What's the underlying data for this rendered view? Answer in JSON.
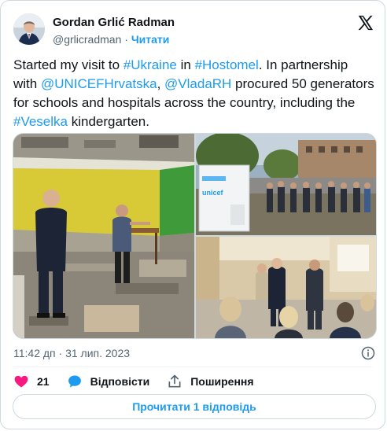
{
  "author": {
    "name": "Gordan Grlić Radman",
    "handle": "@grlicradman",
    "separator": "·",
    "follow_label": "Читати"
  },
  "tweet": {
    "segments": [
      {
        "text": "Started my visit to ",
        "tag": false
      },
      {
        "text": "#Ukraine",
        "tag": true
      },
      {
        "text": " in ",
        "tag": false
      },
      {
        "text": "#Hostomel",
        "tag": true
      },
      {
        "text": ". In partnership with ",
        "tag": false
      },
      {
        "text": "@UNICEFHrvatska",
        "tag": true
      },
      {
        "text": ", ",
        "tag": false
      },
      {
        "text": "@VladaRH",
        "tag": true
      },
      {
        "text": " procured 50 generators for schools and hospitals across the country, including the ",
        "tag": false
      },
      {
        "text": "#Veselka",
        "tag": true
      },
      {
        "text": " kindergarten.",
        "tag": false
      }
    ],
    "timestamp": "11:42 дп · 31 лип. 2023"
  },
  "media": {
    "photo_1": "classroom-ruins-photo",
    "photo_2": "unicef-generator-photo",
    "photo_3": "meeting-hall-photo",
    "generator_brand": "unicef"
  },
  "actions": {
    "likes_count": "21",
    "reply_label": "Відповісти",
    "share_label": "Поширення"
  },
  "read_replies_label": "Прочитати 1 відповідь",
  "colors": {
    "accent": "#1d9bf0",
    "like": "#f91880",
    "text": "#0f1419",
    "muted": "#536471",
    "border": "#cfd9de"
  },
  "icons": [
    "x-logo-icon",
    "info-icon",
    "heart-icon",
    "reply-bubble-icon",
    "share-icon",
    "verified-avatar"
  ]
}
